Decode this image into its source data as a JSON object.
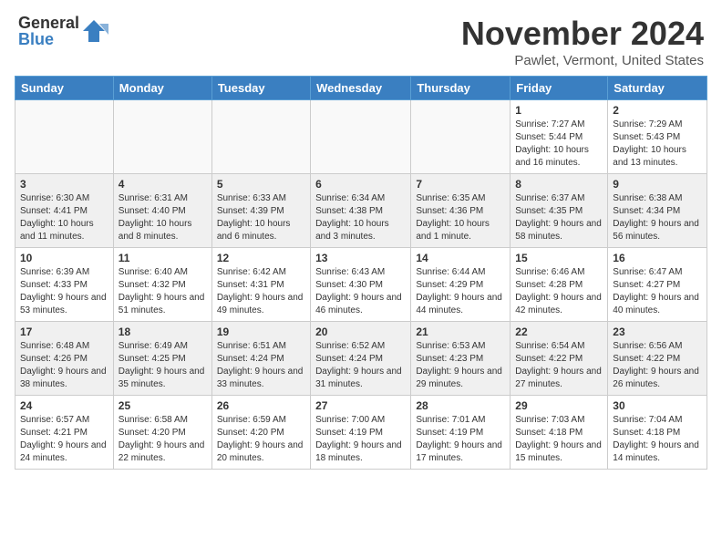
{
  "logo": {
    "general": "General",
    "blue": "Blue"
  },
  "title": "November 2024",
  "location": "Pawlet, Vermont, United States",
  "headers": [
    "Sunday",
    "Monday",
    "Tuesday",
    "Wednesday",
    "Thursday",
    "Friday",
    "Saturday"
  ],
  "weeks": [
    [
      {
        "day": "",
        "info": "",
        "empty": true
      },
      {
        "day": "",
        "info": "",
        "empty": true
      },
      {
        "day": "",
        "info": "",
        "empty": true
      },
      {
        "day": "",
        "info": "",
        "empty": true
      },
      {
        "day": "",
        "info": "",
        "empty": true
      },
      {
        "day": "1",
        "info": "Sunrise: 7:27 AM\nSunset: 5:44 PM\nDaylight: 10 hours and 16 minutes.",
        "empty": false
      },
      {
        "day": "2",
        "info": "Sunrise: 7:29 AM\nSunset: 5:43 PM\nDaylight: 10 hours and 13 minutes.",
        "empty": false
      }
    ],
    [
      {
        "day": "3",
        "info": "Sunrise: 6:30 AM\nSunset: 4:41 PM\nDaylight: 10 hours and 11 minutes.",
        "empty": false
      },
      {
        "day": "4",
        "info": "Sunrise: 6:31 AM\nSunset: 4:40 PM\nDaylight: 10 hours and 8 minutes.",
        "empty": false
      },
      {
        "day": "5",
        "info": "Sunrise: 6:33 AM\nSunset: 4:39 PM\nDaylight: 10 hours and 6 minutes.",
        "empty": false
      },
      {
        "day": "6",
        "info": "Sunrise: 6:34 AM\nSunset: 4:38 PM\nDaylight: 10 hours and 3 minutes.",
        "empty": false
      },
      {
        "day": "7",
        "info": "Sunrise: 6:35 AM\nSunset: 4:36 PM\nDaylight: 10 hours and 1 minute.",
        "empty": false
      },
      {
        "day": "8",
        "info": "Sunrise: 6:37 AM\nSunset: 4:35 PM\nDaylight: 9 hours and 58 minutes.",
        "empty": false
      },
      {
        "day": "9",
        "info": "Sunrise: 6:38 AM\nSunset: 4:34 PM\nDaylight: 9 hours and 56 minutes.",
        "empty": false
      }
    ],
    [
      {
        "day": "10",
        "info": "Sunrise: 6:39 AM\nSunset: 4:33 PM\nDaylight: 9 hours and 53 minutes.",
        "empty": false
      },
      {
        "day": "11",
        "info": "Sunrise: 6:40 AM\nSunset: 4:32 PM\nDaylight: 9 hours and 51 minutes.",
        "empty": false
      },
      {
        "day": "12",
        "info": "Sunrise: 6:42 AM\nSunset: 4:31 PM\nDaylight: 9 hours and 49 minutes.",
        "empty": false
      },
      {
        "day": "13",
        "info": "Sunrise: 6:43 AM\nSunset: 4:30 PM\nDaylight: 9 hours and 46 minutes.",
        "empty": false
      },
      {
        "day": "14",
        "info": "Sunrise: 6:44 AM\nSunset: 4:29 PM\nDaylight: 9 hours and 44 minutes.",
        "empty": false
      },
      {
        "day": "15",
        "info": "Sunrise: 6:46 AM\nSunset: 4:28 PM\nDaylight: 9 hours and 42 minutes.",
        "empty": false
      },
      {
        "day": "16",
        "info": "Sunrise: 6:47 AM\nSunset: 4:27 PM\nDaylight: 9 hours and 40 minutes.",
        "empty": false
      }
    ],
    [
      {
        "day": "17",
        "info": "Sunrise: 6:48 AM\nSunset: 4:26 PM\nDaylight: 9 hours and 38 minutes.",
        "empty": false
      },
      {
        "day": "18",
        "info": "Sunrise: 6:49 AM\nSunset: 4:25 PM\nDaylight: 9 hours and 35 minutes.",
        "empty": false
      },
      {
        "day": "19",
        "info": "Sunrise: 6:51 AM\nSunset: 4:24 PM\nDaylight: 9 hours and 33 minutes.",
        "empty": false
      },
      {
        "day": "20",
        "info": "Sunrise: 6:52 AM\nSunset: 4:24 PM\nDaylight: 9 hours and 31 minutes.",
        "empty": false
      },
      {
        "day": "21",
        "info": "Sunrise: 6:53 AM\nSunset: 4:23 PM\nDaylight: 9 hours and 29 minutes.",
        "empty": false
      },
      {
        "day": "22",
        "info": "Sunrise: 6:54 AM\nSunset: 4:22 PM\nDaylight: 9 hours and 27 minutes.",
        "empty": false
      },
      {
        "day": "23",
        "info": "Sunrise: 6:56 AM\nSunset: 4:22 PM\nDaylight: 9 hours and 26 minutes.",
        "empty": false
      }
    ],
    [
      {
        "day": "24",
        "info": "Sunrise: 6:57 AM\nSunset: 4:21 PM\nDaylight: 9 hours and 24 minutes.",
        "empty": false
      },
      {
        "day": "25",
        "info": "Sunrise: 6:58 AM\nSunset: 4:20 PM\nDaylight: 9 hours and 22 minutes.",
        "empty": false
      },
      {
        "day": "26",
        "info": "Sunrise: 6:59 AM\nSunset: 4:20 PM\nDaylight: 9 hours and 20 minutes.",
        "empty": false
      },
      {
        "day": "27",
        "info": "Sunrise: 7:00 AM\nSunset: 4:19 PM\nDaylight: 9 hours and 18 minutes.",
        "empty": false
      },
      {
        "day": "28",
        "info": "Sunrise: 7:01 AM\nSunset: 4:19 PM\nDaylight: 9 hours and 17 minutes.",
        "empty": false
      },
      {
        "day": "29",
        "info": "Sunrise: 7:03 AM\nSunset: 4:18 PM\nDaylight: 9 hours and 15 minutes.",
        "empty": false
      },
      {
        "day": "30",
        "info": "Sunrise: 7:04 AM\nSunset: 4:18 PM\nDaylight: 9 hours and 14 minutes.",
        "empty": false
      }
    ]
  ]
}
